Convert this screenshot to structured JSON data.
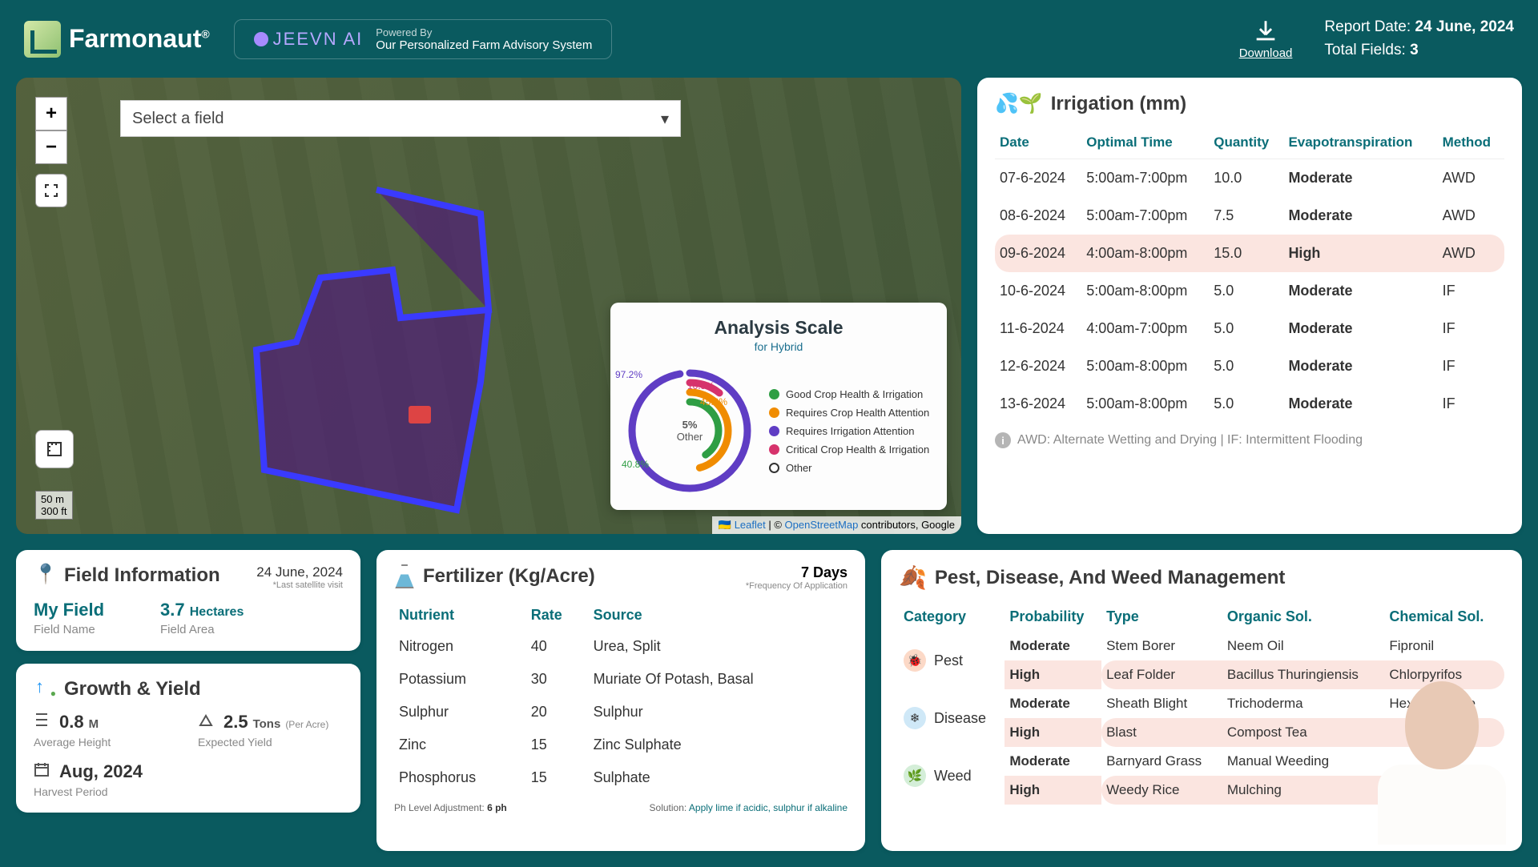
{
  "header": {
    "brand": "Farmonaut",
    "brandSup": "®",
    "jeevn": {
      "logo": "JEEVN AI",
      "poweredBy": "Powered By",
      "tagline": "Our Personalized Farm Advisory System"
    },
    "download": "Download",
    "reportDateLabel": "Report Date: ",
    "reportDate": "24 June, 2024",
    "totalFieldsLabel": "Total Fields: ",
    "totalFields": "3"
  },
  "map": {
    "selectPlaceholder": "Select a field",
    "scale1": "50 m",
    "scale2": "300 ft",
    "attrib": {
      "leaflet": "Leaflet",
      "osm": "OpenStreetMap",
      "rest": " contributors, Google"
    },
    "analysis": {
      "title": "Analysis Scale",
      "subtitle": "for Hybrid",
      "center": "5%",
      "centerSub": "Other",
      "labels": {
        "purple": "97.2%",
        "red": "10.5%",
        "orange": "45.8%",
        "green": "40.8%"
      },
      "legend": [
        {
          "color": "#2f9e44",
          "text": "Good Crop Health & Irrigation"
        },
        {
          "color": "#f08c00",
          "text": "Requires Crop Health Attention"
        },
        {
          "color": "#5f3dc4",
          "text": "Requires Irrigation Attention"
        },
        {
          "color": "#d6336c",
          "text": "Critical Crop Health & Irrigation"
        },
        {
          "color": "#ffffff",
          "text": "Other",
          "border": true
        }
      ]
    }
  },
  "irrigation": {
    "title": "Irrigation (mm)",
    "cols": [
      "Date",
      "Optimal Time",
      "Quantity",
      "Evapotranspiration",
      "Method"
    ],
    "rows": [
      {
        "date": "07-6-2024",
        "time": "5:00am-7:00pm",
        "qty": "10.0",
        "evap": "Moderate",
        "method": "AWD",
        "level": "mod"
      },
      {
        "date": "08-6-2024",
        "time": "5:00am-7:00pm",
        "qty": "7.5",
        "evap": "Moderate",
        "method": "AWD",
        "level": "mod"
      },
      {
        "date": "09-6-2024",
        "time": "4:00am-8:00pm",
        "qty": "15.0",
        "evap": "High",
        "method": "AWD",
        "level": "high"
      },
      {
        "date": "10-6-2024",
        "time": "5:00am-8:00pm",
        "qty": "5.0",
        "evap": "Moderate",
        "method": "IF",
        "level": "mod"
      },
      {
        "date": "11-6-2024",
        "time": "4:00am-7:00pm",
        "qty": "5.0",
        "evap": "Moderate",
        "method": "IF",
        "level": "mod"
      },
      {
        "date": "12-6-2024",
        "time": "5:00am-8:00pm",
        "qty": "5.0",
        "evap": "Moderate",
        "method": "IF",
        "level": "mod"
      },
      {
        "date": "13-6-2024",
        "time": "5:00am-8:00pm",
        "qty": "5.0",
        "evap": "Moderate",
        "method": "IF",
        "level": "mod"
      }
    ],
    "note": "AWD: Alternate Wetting and Drying | IF: Intermittent Flooding"
  },
  "fieldInfo": {
    "title": "Field Information",
    "date": "24 June, 2024",
    "dateNote": "*Last satellite visit",
    "name": "My Field",
    "nameLbl": "Field Name",
    "area": "3.7",
    "areaUnit": "Hectares",
    "areaLbl": "Field Area"
  },
  "growth": {
    "title": "Growth & Yield",
    "height": "0.8",
    "heightUnit": "M",
    "heightLbl": "Average Height",
    "yield": "2.5",
    "yieldUnit": "Tons",
    "yieldSub": "(Per Acre)",
    "yieldLbl": "Expected Yield",
    "harvest": "Aug, 2024",
    "harvestLbl": "Harvest Period"
  },
  "fertilizer": {
    "title": "Fertilizer (Kg/Acre)",
    "freq": "7 Days",
    "freqNote": "*Frequency Of Application",
    "cols": [
      "Nutrient",
      "Rate",
      "Source"
    ],
    "rows": [
      {
        "n": "Nitrogen",
        "r": "40",
        "s": "Urea, Split"
      },
      {
        "n": "Potassium",
        "r": "30",
        "s": "Muriate Of Potash, Basal"
      },
      {
        "n": "Sulphur",
        "r": "20",
        "s": "Sulphur"
      },
      {
        "n": "Zinc",
        "r": "15",
        "s": "Zinc Sulphate"
      },
      {
        "n": "Phosphorus",
        "r": "15",
        "s": "Sulphate"
      }
    ],
    "phLabel": "Ph Level Adjustment: ",
    "ph": "6 ph",
    "solLabel": "Solution: ",
    "sol": "Apply lime if acidic, sulphur if alkaline"
  },
  "pest": {
    "title": "Pest, Disease, And Weed Management",
    "cols": [
      "Category",
      "Probability",
      "Type",
      "Organic Sol.",
      "Chemical Sol."
    ],
    "groups": [
      {
        "cat": "Pest",
        "icon": "🐞",
        "iconBg": "#fcd9c7",
        "rows": [
          {
            "p": "Moderate",
            "t": "Stem Borer",
            "o": "Neem Oil",
            "c": "Fipronil",
            "lvl": "mod"
          },
          {
            "p": "High",
            "t": "Leaf Folder",
            "o": "Bacillus Thuringiensis",
            "c": "Chlorpyrifos",
            "lvl": "high"
          }
        ]
      },
      {
        "cat": "Disease",
        "icon": "❄",
        "iconBg": "#cfe8f7",
        "rows": [
          {
            "p": "Moderate",
            "t": "Sheath Blight",
            "o": "Trichoderma",
            "c": "Hexaconazole",
            "lvl": "mod"
          },
          {
            "p": "High",
            "t": "Blast",
            "o": "Compost Tea",
            "c": "",
            "lvl": "high"
          }
        ]
      },
      {
        "cat": "Weed",
        "icon": "🌿",
        "iconBg": "#d4eed8",
        "rows": [
          {
            "p": "Moderate",
            "t": "Barnyard Grass",
            "o": "Manual Weeding",
            "c": "",
            "lvl": "mod"
          },
          {
            "p": "High",
            "t": "Weedy Rice",
            "o": "Mulching",
            "c": "",
            "lvl": "high"
          }
        ]
      }
    ]
  }
}
